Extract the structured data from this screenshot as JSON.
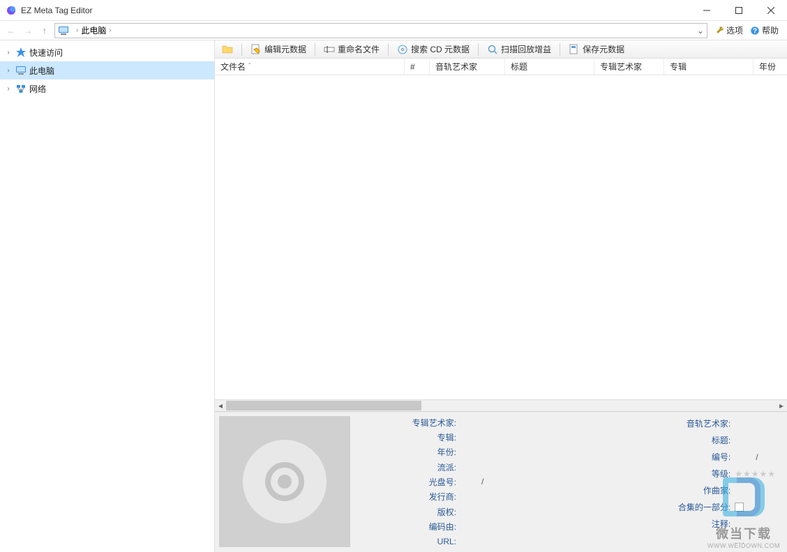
{
  "header": {
    "app_title": "EZ Meta Tag Editor"
  },
  "nav": {
    "breadcrumb": {
      "location": "此电脑"
    },
    "right": {
      "options": "选项",
      "help": "帮助"
    }
  },
  "sidebar": {
    "items": [
      {
        "label": "快速访问",
        "icon": "star"
      },
      {
        "label": "此电脑",
        "icon": "pc",
        "selected": true
      },
      {
        "label": "网络",
        "icon": "network"
      }
    ]
  },
  "toolbar": {
    "items": [
      {
        "label": "编辑元数据"
      },
      {
        "label": "重命名文件"
      },
      {
        "label": "搜索 CD 元数据"
      },
      {
        "label": "扫描回放增益"
      },
      {
        "label": "保存元数据"
      }
    ]
  },
  "columns": {
    "filename": "文件名",
    "num": "#",
    "track_artist": "音轨艺术家",
    "title": "标题",
    "album_artist": "专辑艺术家",
    "album": "专辑",
    "year": "年份"
  },
  "details": {
    "left": {
      "album_artist": "专辑艺术家:",
      "album": "专辑:",
      "year": "年份:",
      "genre": "流派:",
      "disc_no": "光盘号:",
      "disc_no_val": "/",
      "publisher": "发行商:",
      "copyright": "版权:",
      "encoded_by": "编码由:",
      "url": "URL:"
    },
    "right": {
      "track_artist": "音轨艺术家:",
      "title": "标题:",
      "number": "编号:",
      "number_val": "/",
      "rating": "等级:",
      "composer": "作曲家:",
      "compilation": "合集的一部分:",
      "comment": "注释:",
      "more": "..."
    }
  },
  "watermark": {
    "text": "微当下载",
    "url": "WWW.WEIDOWN.COM"
  }
}
